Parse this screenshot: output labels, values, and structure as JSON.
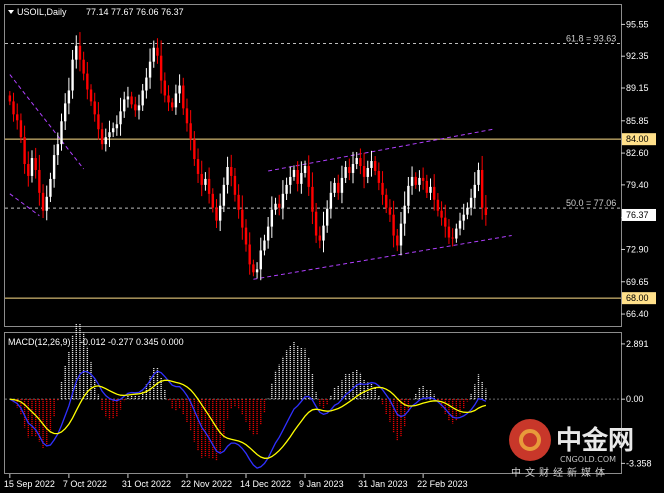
{
  "header": {
    "symbol": "USOIL,Daily",
    "ohlc": "77.14 77.67 76.06 76.37"
  },
  "macd_header": {
    "label": "MACD(12,26,9)",
    "values": "-0.012 -0.277 0.345 0.000"
  },
  "watermark": {
    "cn": "中金网",
    "en": "CNGOLD.COM",
    "sub": "中文财经新媒体"
  },
  "colors": {
    "bg": "#000000",
    "bull": "#ffffff",
    "bear": "#ff0000",
    "level": "#ffe08a",
    "channel": "#b040ff",
    "macd_line": "#3030ff",
    "signal_line": "#ffff00",
    "grid": "#6e6e6e"
  },
  "chart_data": [
    {
      "type": "candlestick",
      "title": "USOIL,Daily",
      "x_ticks": [
        "15 Sep 2022",
        "7 Oct 2022",
        "31 Oct 2022",
        "22 Nov 2022",
        "14 Dec 2022",
        "9 Jan 2023",
        "31 Jan 2023",
        "22 Feb 2023"
      ],
      "y_ticks": [
        95.55,
        92.35,
        89.15,
        85.85,
        82.6,
        79.4,
        76.1,
        72.9,
        69.65,
        66.4
      ],
      "ylim": [
        65.6,
        97.0
      ],
      "current_price": 76.37,
      "horizontal_levels": [
        {
          "label": "84.00",
          "value": 84.0
        },
        {
          "label": "68.00",
          "value": 68.0
        }
      ],
      "fib_levels": [
        {
          "label": "61.8 = 93.63",
          "value": 93.63
        },
        {
          "label": "50.0 = 77.06",
          "value": 77.06
        }
      ],
      "trend_channels": [
        {
          "from": {
            "bar": 0,
            "price": 90.5
          },
          "to": {
            "bar": 20,
            "price": 81.0
          }
        },
        {
          "from": {
            "bar": 0,
            "price": 78.5
          },
          "to": {
            "bar": 8,
            "price": 76.3
          }
        },
        {
          "from": {
            "bar": 70,
            "price": 80.8
          },
          "to": {
            "bar": 131,
            "price": 85.0
          }
        },
        {
          "from": {
            "bar": 66,
            "price": 69.9
          },
          "to": {
            "bar": 136,
            "price": 74.3
          }
        }
      ],
      "close": [
        87.8,
        86.5,
        85.9,
        84.2,
        81.5,
        80.3,
        82.1,
        80.9,
        78.6,
        76.8,
        78.2,
        80.0,
        82.4,
        83.5,
        85.8,
        87.6,
        88.9,
        92.0,
        93.4,
        92.0,
        90.6,
        89.0,
        87.8,
        86.5,
        85.0,
        83.5,
        84.2,
        84.7,
        85.1,
        85.5,
        86.8,
        88.0,
        88.3,
        87.5,
        86.9,
        87.4,
        88.9,
        90.2,
        91.8,
        93.2,
        92.4,
        89.9,
        88.4,
        87.7,
        87.2,
        88.6,
        89.4,
        87.1,
        85.6,
        84.0,
        82.0,
        80.5,
        79.4,
        80.0,
        78.5,
        77.1,
        75.8,
        77.3,
        79.4,
        81.2,
        80.3,
        78.4,
        76.9,
        75.1,
        73.4,
        71.4,
        70.6,
        70.9,
        72.8,
        73.8,
        75.2,
        76.9,
        77.5,
        77.1,
        78.5,
        79.4,
        80.2,
        80.9,
        79.5,
        80.6,
        81.3,
        79.2,
        76.7,
        74.3,
        73.8,
        75.3,
        77.0,
        78.6,
        79.6,
        78.6,
        80.1,
        81.2,
        80.6,
        81.5,
        82.1,
        81.3,
        80.2,
        81.1,
        81.8,
        80.8,
        79.6,
        78.4,
        77.1,
        76.4,
        74.3,
        73.3,
        75.5,
        77.3,
        79.3,
        80.2,
        79.4,
        80.1,
        79.8,
        78.6,
        79.2,
        77.9,
        76.8,
        76.1,
        75.2,
        74.1,
        74.0,
        75.0,
        75.8,
        76.4,
        77.1,
        78.1,
        79.4,
        80.9,
        77.1,
        76.37
      ]
    },
    {
      "type": "histogram",
      "title": "MACD(12,26,9)",
      "y_ticks": [
        2.891,
        0.0,
        -3.358
      ],
      "ylim": [
        -3.6,
        3.2
      ],
      "values": {
        "main": -0.012,
        "signal": -0.277,
        "osma": 0.345,
        "extra": 0.0
      }
    }
  ]
}
